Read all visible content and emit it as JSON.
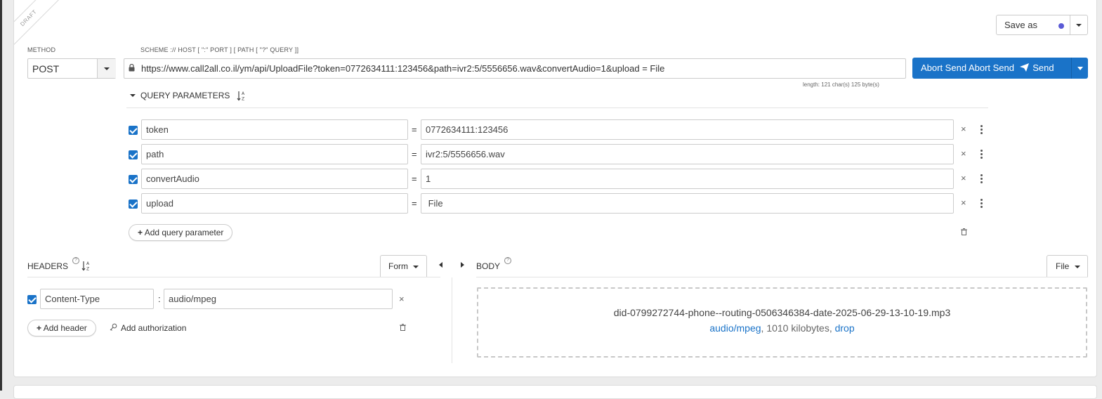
{
  "ribbon": "DRAFT",
  "save": {
    "label": "Save as"
  },
  "method": {
    "label": "METHOD",
    "value": "POST"
  },
  "url": {
    "label": "SCHEME :// HOST [ \":\" PORT ] [ PATH [ \"?\" QUERY ]]",
    "value": "https://www.call2all.co.il/ym/api/UploadFile?token=0772634111:123456&path=ivr2:5/5556656.wav&convertAudio=1&upload = File",
    "length": "length: 121 char(s) 125 byte(s)"
  },
  "send": {
    "label": "Abort Send Abort Send",
    "send_text": "Send"
  },
  "query": {
    "title": "QUERY PARAMETERS",
    "params": [
      {
        "key": "token",
        "value": "0772634111:123456"
      },
      {
        "key": "path",
        "value": "ivr2:5/5556656.wav"
      },
      {
        "key": "convertAudio",
        "value": "1"
      },
      {
        "key": "upload",
        "value": " File"
      }
    ],
    "add_label": "Add query parameter"
  },
  "headers": {
    "title": "HEADERS",
    "mode": "Form",
    "items": [
      {
        "key": "Content-Type",
        "value": "audio/mpeg"
      }
    ],
    "add_label": "Add header",
    "auth_label": "Add authorization"
  },
  "body": {
    "title": "BODY",
    "mode": "File",
    "file_name": "did-0799272744-phone--routing-0506346384-date-2025-06-29-13-10-19.mp3",
    "mime": "audio/mpeg",
    "sep1": ", ",
    "size": "1010 kilobytes",
    "sep2": ", ",
    "drop": "drop"
  },
  "colors": {
    "accent": "#1a73c8",
    "dot": "#5b5bd6"
  }
}
